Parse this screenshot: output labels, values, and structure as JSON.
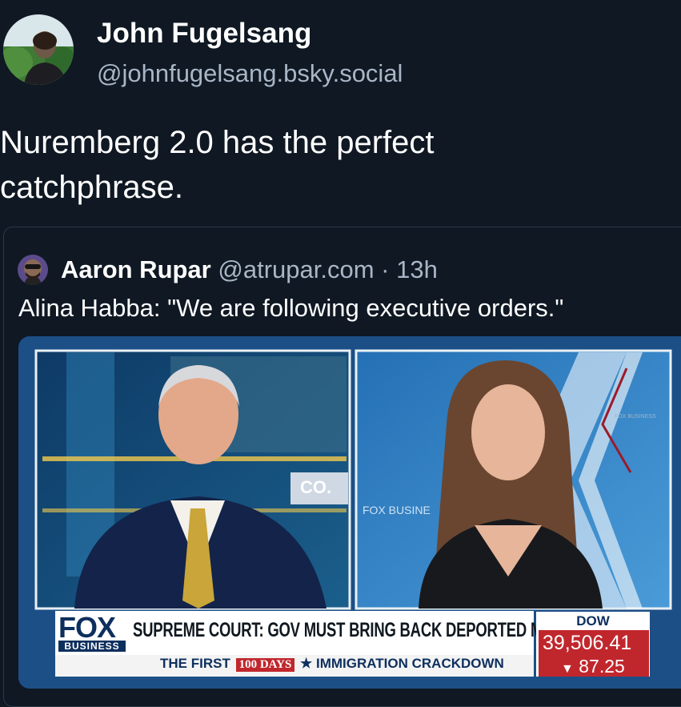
{
  "author": {
    "name": "John Fugelsang",
    "handle": "@johnfugelsang.bsky.social"
  },
  "post": {
    "lines": [
      "Nuremberg 2.0 has the perfect",
      "catchphrase."
    ]
  },
  "quoted_post": {
    "name": "Aaron Rupar",
    "handle": "@atrupar.com",
    "separator": "·",
    "time": "13h",
    "text": "Alina Habba: \"We are following executive orders.\""
  },
  "video": {
    "left_screen_text": "CO.",
    "right_screen_text": "FOX BUSINE",
    "logo_small": "FOX BUSINESS",
    "network_logo": "FOX",
    "network_sub": "BUSINESS",
    "headline": "SUPREME COURT: GOV MUST BRING BACK DEPORTED MD MAN",
    "subline_left": "THE FIRST",
    "subline_badge": "100 DAYS",
    "subline_right": "IMMIGRATION CRACKDOWN",
    "dow_label": "DOW",
    "dow_value": "39,506.41",
    "dow_change": "87.25"
  },
  "colors": {
    "background": "#0f1823",
    "secondary_text": "#a9b6c6",
    "fox_navy": "#0d2f5e",
    "ticker_red": "#c0272d"
  }
}
